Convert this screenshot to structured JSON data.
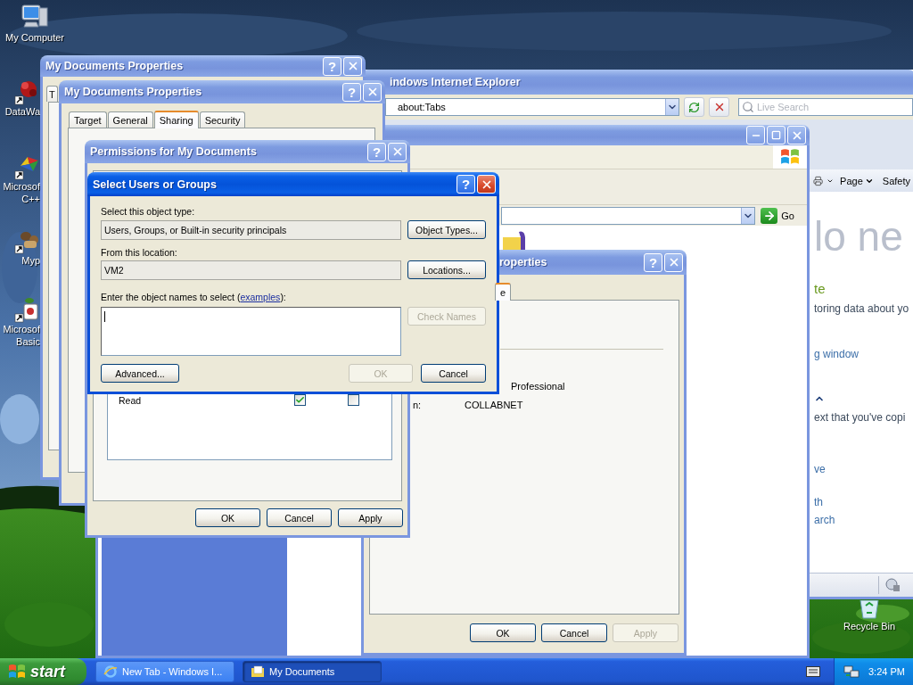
{
  "desktop_icons": [
    {
      "kind": "computer",
      "lines": [
        "My Computer"
      ]
    },
    {
      "kind": "red_app",
      "lines": [
        "DataWa"
      ]
    },
    {
      "kind": "cpp_app",
      "lines": [
        "Microsof",
        "C++"
      ]
    },
    {
      "kind": "brown_app",
      "lines": [
        "Myp"
      ]
    },
    {
      "kind": "basic_app",
      "lines": [
        "Microsof",
        "Basic"
      ]
    },
    {
      "kind": "recycle_bin",
      "lines": [
        "Recycle Bin"
      ]
    }
  ],
  "ie_window": {
    "title": "indows Internet Explorer",
    "address": "about:Tabs",
    "search_placeholder": "Live Search",
    "menus": [
      "Page",
      "Safety"
    ],
    "page_heading": "lo ne",
    "page_lines": [
      {
        "kind": "heading",
        "text": "te"
      },
      {
        "kind": "body",
        "text": "toring data about yo"
      },
      {
        "kind": "link",
        "text": "g window"
      },
      {
        "kind": "chevron"
      },
      {
        "kind": "body",
        "text": "ext that you've copi"
      },
      {
        "kind": "link",
        "text": "ve"
      },
      {
        "kind": "link",
        "text": "th"
      },
      {
        "kind": "link",
        "text": "arch"
      }
    ]
  },
  "explorer_window": {
    "go_button": "Go"
  },
  "properties_right": {
    "title": "roperties",
    "help": "?",
    "tab": {
      "label": "e",
      "selected": true
    },
    "os": "Professional",
    "label_fragment": "n:",
    "domain": "COLLABNET",
    "buttons": [
      {
        "label": "OK",
        "disabled": false
      },
      {
        "label": "Cancel",
        "disabled": false
      },
      {
        "label": "Apply",
        "disabled": true
      }
    ]
  },
  "properties_back": {
    "title": "My Documents Properties",
    "help": "?",
    "tabs": [
      {
        "label": "T",
        "selected": false
      }
    ]
  },
  "properties_front": {
    "title": "My Documents Properties",
    "help": "?",
    "tabs": [
      {
        "label": "Target",
        "selected": false
      },
      {
        "label": "General",
        "selected": false
      },
      {
        "label": "Sharing",
        "selected": true
      },
      {
        "label": "Security",
        "selected": false
      }
    ]
  },
  "permissions": {
    "title": "Permissions for My Documents",
    "help": "?",
    "rows": [
      {
        "label": "Read",
        "allow": true,
        "deny": false
      }
    ],
    "buttons": [
      {
        "label": "OK",
        "disabled": false
      },
      {
        "label": "Cancel",
        "disabled": false
      },
      {
        "label": "Apply",
        "disabled": false
      }
    ]
  },
  "select_dialog": {
    "title": "Select Users or Groups",
    "help": "?",
    "object_type_label": "Select this object type:",
    "object_type": "Users, Groups, or Built-in security principals",
    "object_types_button": {
      "label": "Object Types...",
      "disabled": false
    },
    "location_label": "From this location:",
    "location": "VM2",
    "locations_button": {
      "label": "Locations...",
      "disabled": false
    },
    "names_label_before": "Enter the object names to select (",
    "names_link": "examples",
    "names_label_after": "):",
    "check_names_button": {
      "label": "Check Names",
      "disabled": true
    },
    "advanced_button": {
      "label": "Advanced...",
      "disabled": false
    },
    "ok_button": {
      "label": "OK",
      "disabled": true
    },
    "cancel_button": {
      "label": "Cancel",
      "disabled": false
    }
  },
  "taskbar": {
    "start": "start",
    "tasks": [
      {
        "kind": "browser",
        "label": "New Tab - Windows I...",
        "selected": false
      },
      {
        "kind": "folder",
        "label": "My Documents",
        "selected": true
      }
    ],
    "clock": "3:24 PM"
  }
}
